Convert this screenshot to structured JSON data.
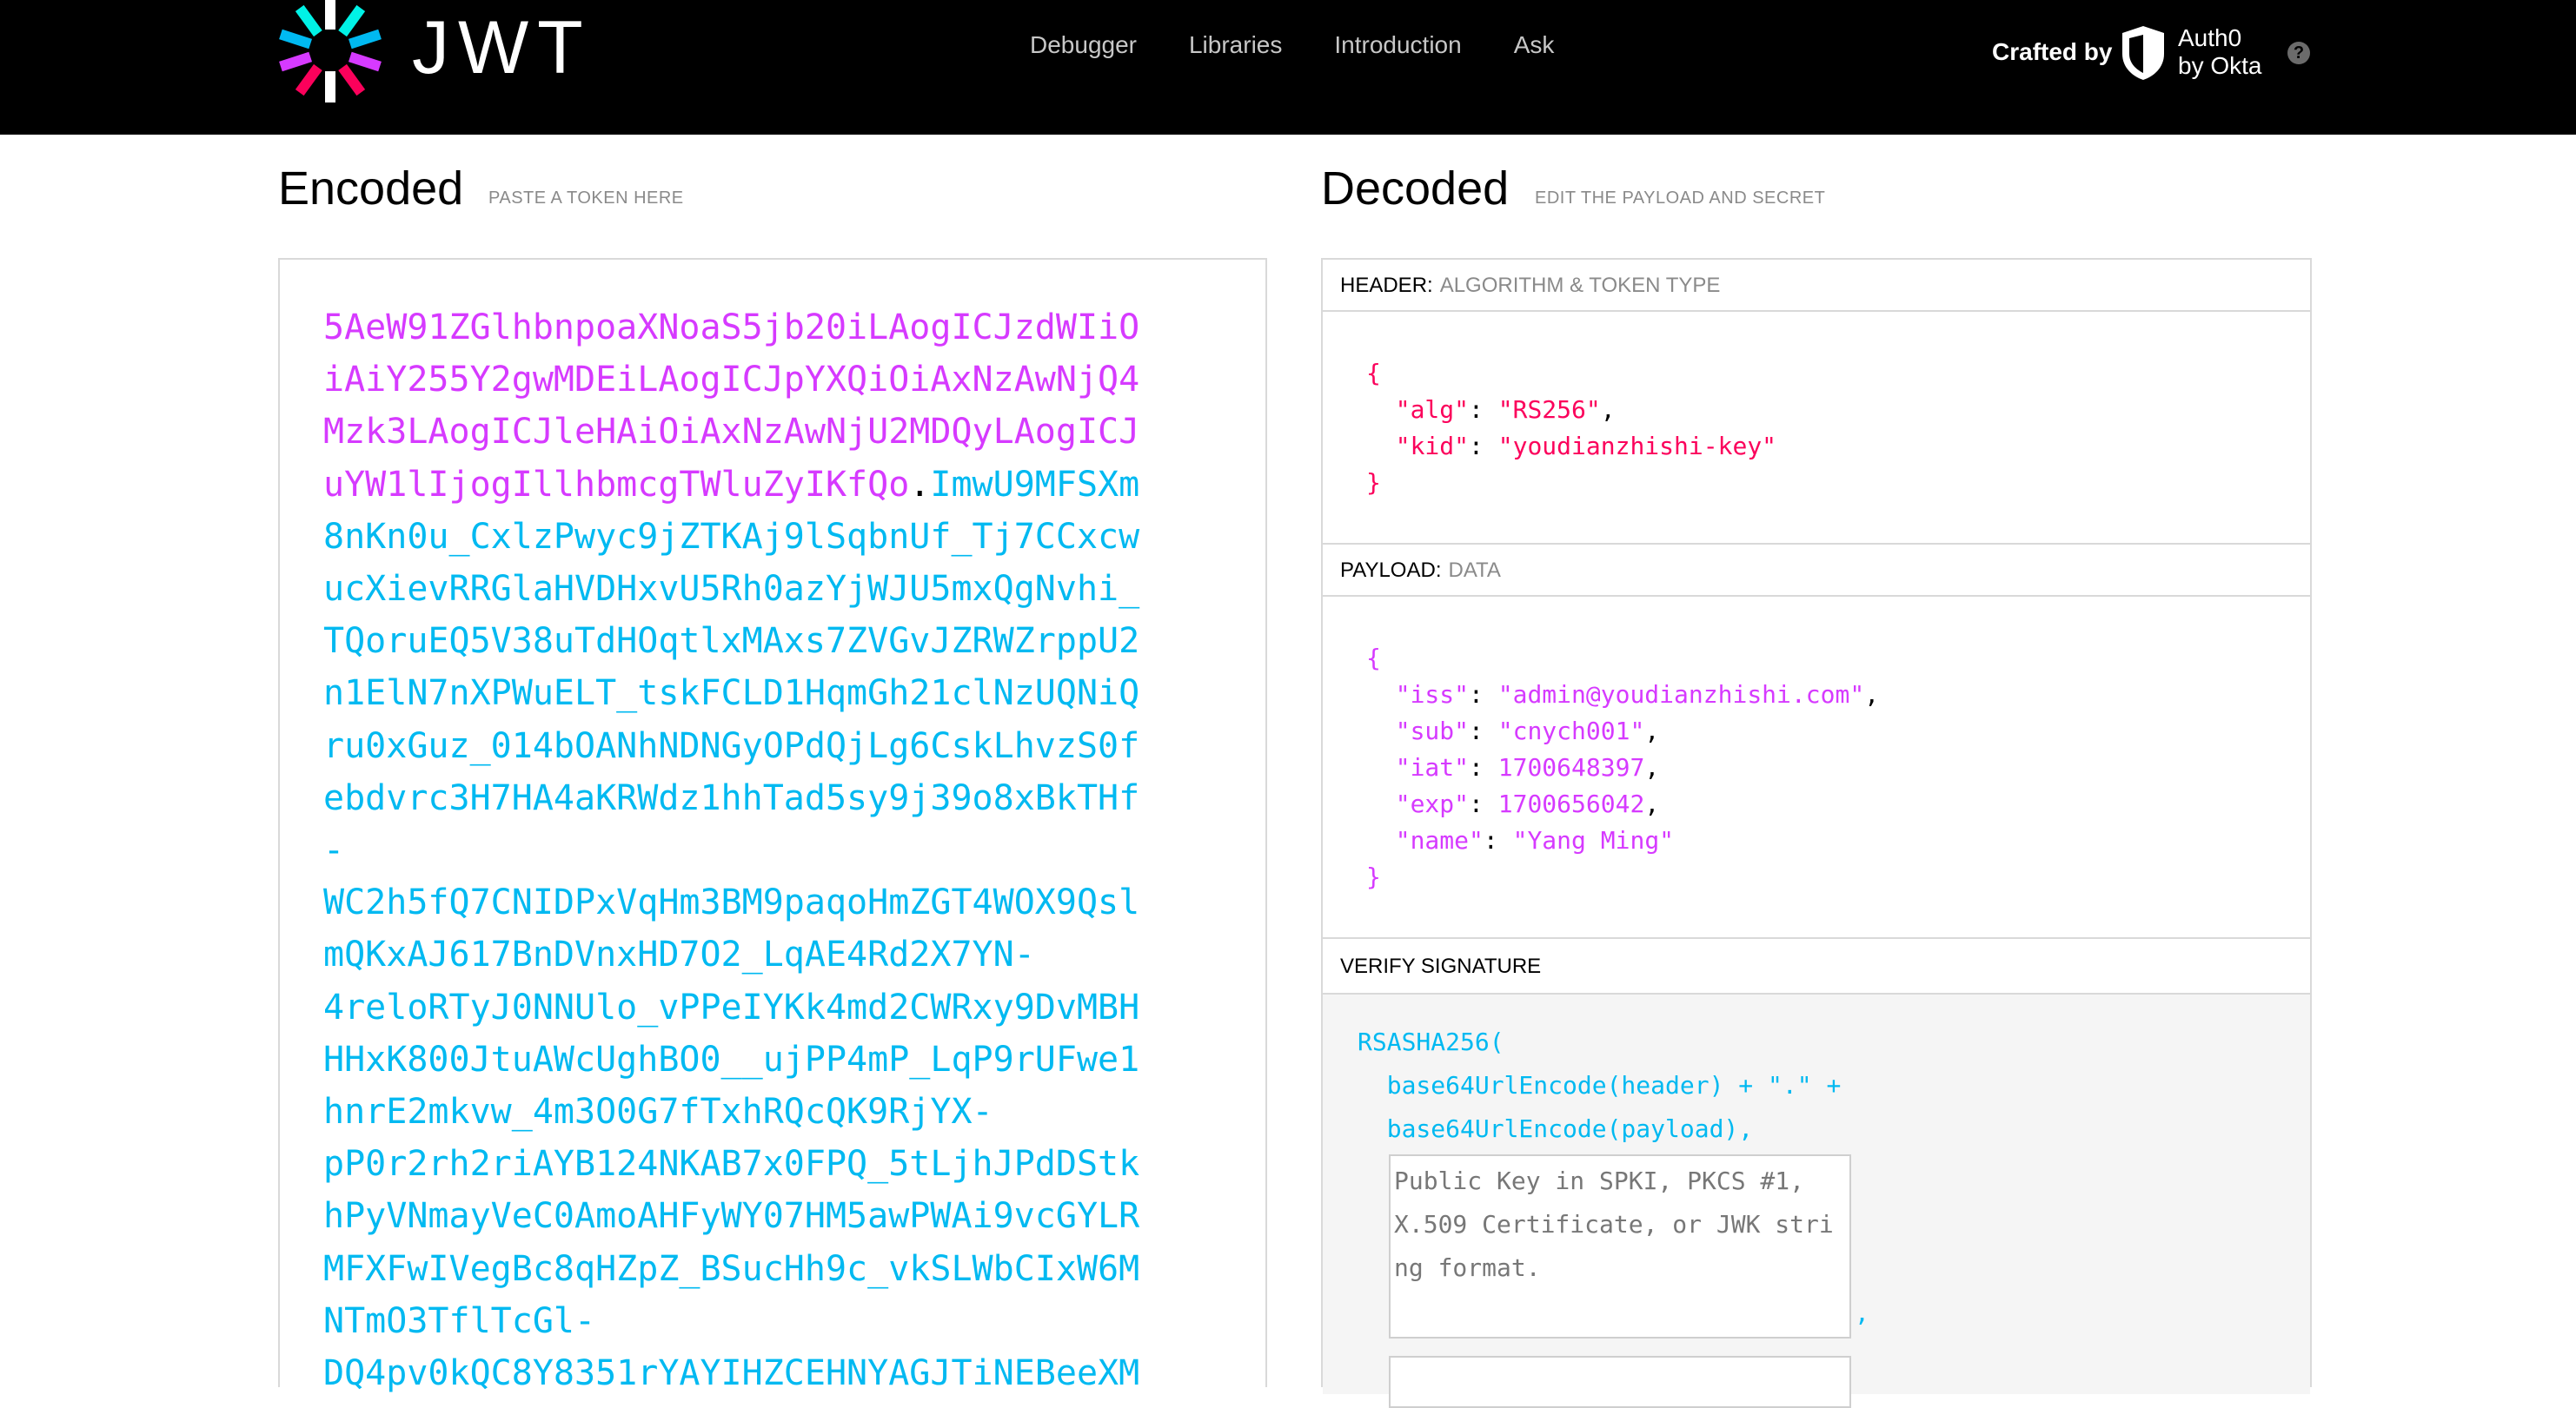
{
  "header": {
    "brand": "JWT",
    "nav": [
      "Debugger",
      "Libraries",
      "Introduction",
      "Ask"
    ],
    "crafted_by": "Crafted by",
    "auth0_line1": "Auth0",
    "auth0_line2": "by Okta",
    "help": "?"
  },
  "encoded": {
    "title": "Encoded",
    "subtitle": "PASTE A TOKEN HERE",
    "payload_lines": [
      "5AeW91ZGlhbnpoaXNoaS5jb20iLAogICJzdWIiO",
      "iAiY255Y2gwMDEiLAogICJpYXQiOiAxNzAwNjQ4",
      "Mzk3LAogICJleHAiOiAxNzAwNjU2MDQyLAogICJ",
      "uYW1lIjogIllhbmcgTWluZyIKfQo"
    ],
    "dot": ".",
    "signature_first": "ImwU9MFSXm",
    "signature_lines": [
      "8nKn0u_CxlzPwyc9jZTKAj9lSqbnUf_Tj7CCxcw",
      "ucXievRRGlaHVDHxvU5Rh0azYjWJU5mxQgNvhi_",
      "TQoruEQ5V38uTdHOqtlxMAxs7ZVGvJZRWZrppU2",
      "n1ElN7nXPWuELT_tskFCLD1HqmGh21clNzUQNiQ",
      "ru0xGuz_014bOANhNDNGyOPdQjLg6CskLhvzS0f",
      "ebdvrc3H7HA4aKRWdz1hhTad5sy9j39o8xBkTHf",
      "-",
      "WC2h5fQ7CNIDPxVqHm3BM9paqoHmZGT4WOX9Qsl",
      "mQKxAJ617BnDVnxHD7O2_LqAE4Rd2X7YN-",
      "4reloRTyJ0NNUlo_vPPeIYKk4md2CWRxy9DvMBH",
      "HHxK800JtuAWcUghBO0__ujPP4mP_LqP9rUFwe1",
      "hnrE2mkvw_4m3O0G7fTxhRQcQK9RjYX-",
      "pP0r2rh2riAYB124NKAB7x0FPQ_5tLjhJPdDStk",
      "hPyVNmayVeC0AmoAHFyWY07HM5awPWAi9vcGYLR",
      "MFXFwIVegBc8qHZpZ_BSucHh9c_vkSLWbCIxW6M",
      "NTmO3TflTcGl-",
      "DQ4pv0kQC8Y8351rYAYIHZCEHNYAGJTiNEBeeXM"
    ]
  },
  "decoded": {
    "title": "Decoded",
    "subtitle": "EDIT THE PAYLOAD AND SECRET",
    "header_label": "HEADER:",
    "header_muted": "ALGORITHM & TOKEN TYPE",
    "header_json": {
      "alg": "RS256",
      "kid": "youdianzhishi-key"
    },
    "payload_label": "PAYLOAD:",
    "payload_muted": "DATA",
    "payload_json": {
      "iss": "admin@youdianzhishi.com",
      "sub": "cnych001",
      "iat": "1700648397",
      "exp": "1700656042",
      "name": "Yang Ming"
    },
    "verify_label": "VERIFY SIGNATURE",
    "verify_line1": "RSASHA256(",
    "verify_line2": "  base64UrlEncode(header) + \".\" +",
    "verify_line3": "  base64UrlEncode(payload),",
    "public_key_placeholder": "Public Key in SPKI, PKCS #1, X.509 Certificate, or JWK string format.",
    "comma": ","
  },
  "colors": {
    "payload": "#d63aff",
    "signature": "#00b9f1",
    "header_json": "#fb015b"
  }
}
